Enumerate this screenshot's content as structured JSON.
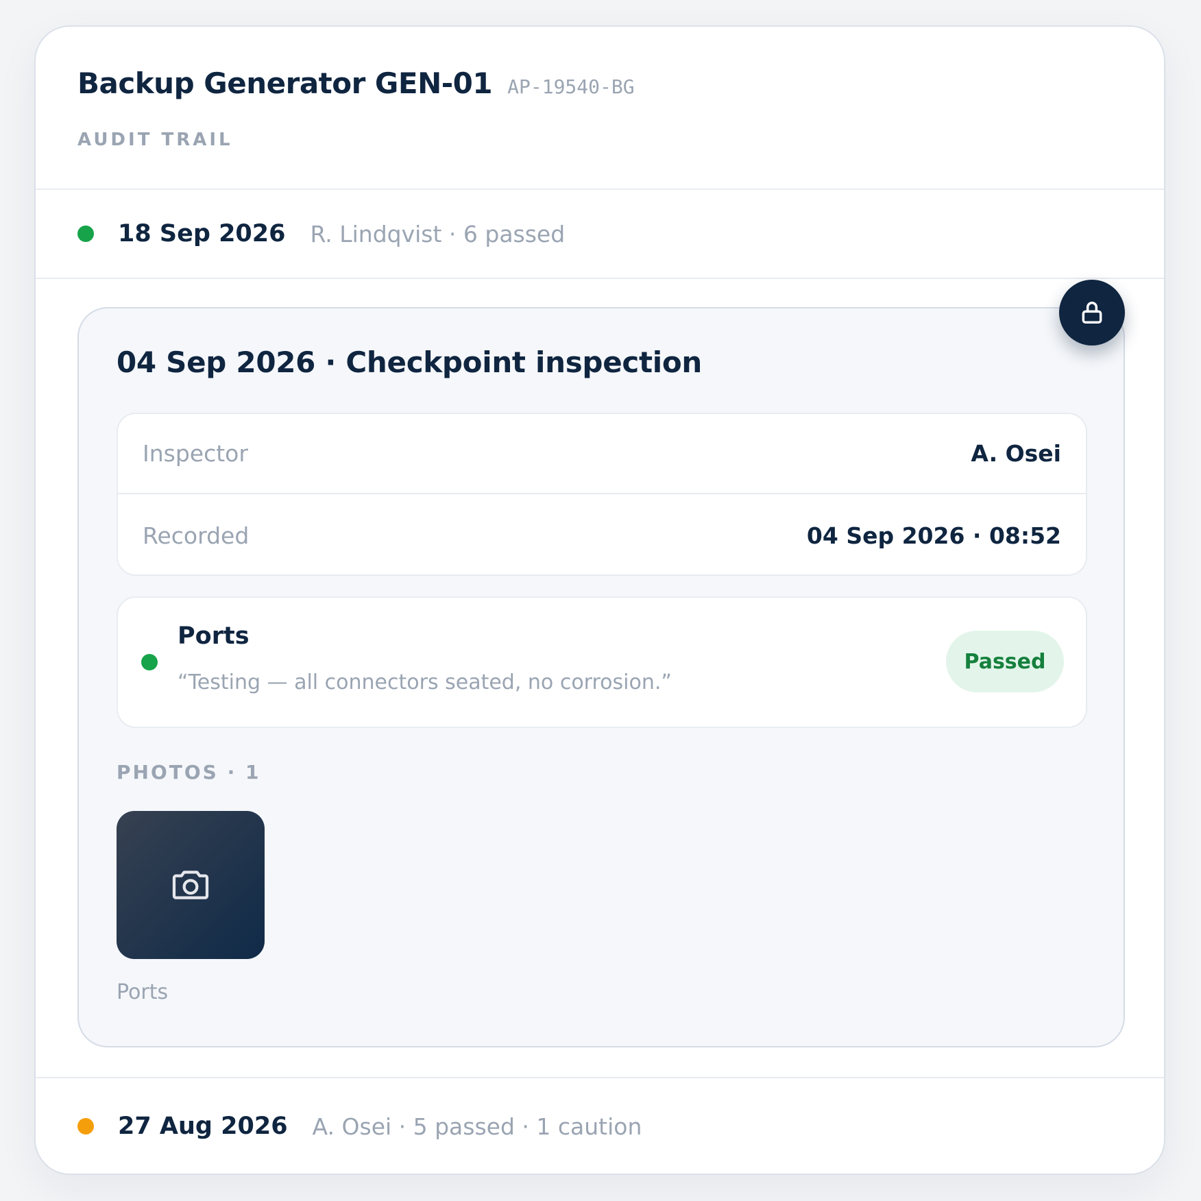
{
  "asset": {
    "title": "Backup Generator GEN-01",
    "id": "AP-19540-BG"
  },
  "section_label": "AUDIT TRAIL",
  "colors": {
    "passed": "#16a34a",
    "caution": "#f59e0b",
    "navy": "#0f2540"
  },
  "entries": [
    {
      "date": "18 Sep 2026",
      "meta": "R. Lindqvist · 6 passed",
      "status": "passed"
    },
    {
      "date": "27 Aug 2026",
      "meta": "A. Osei · 5 passed · 1 caution",
      "status": "caution"
    }
  ],
  "detail": {
    "title": "04 Sep 2026 · Checkpoint inspection",
    "lock_icon": "lock-icon",
    "fields": [
      {
        "label": "Inspector",
        "value": "A. Osei"
      },
      {
        "label": "Recorded",
        "value": "04 Sep 2026 · 08:52"
      }
    ],
    "checkpoint": {
      "name": "Ports",
      "note": "“Testing — all connectors seated, no corrosion.”",
      "status": "Passed"
    },
    "photos_label": "PHOTOS · 1",
    "photos": [
      {
        "caption": "Ports",
        "icon": "camera-icon"
      }
    ]
  }
}
